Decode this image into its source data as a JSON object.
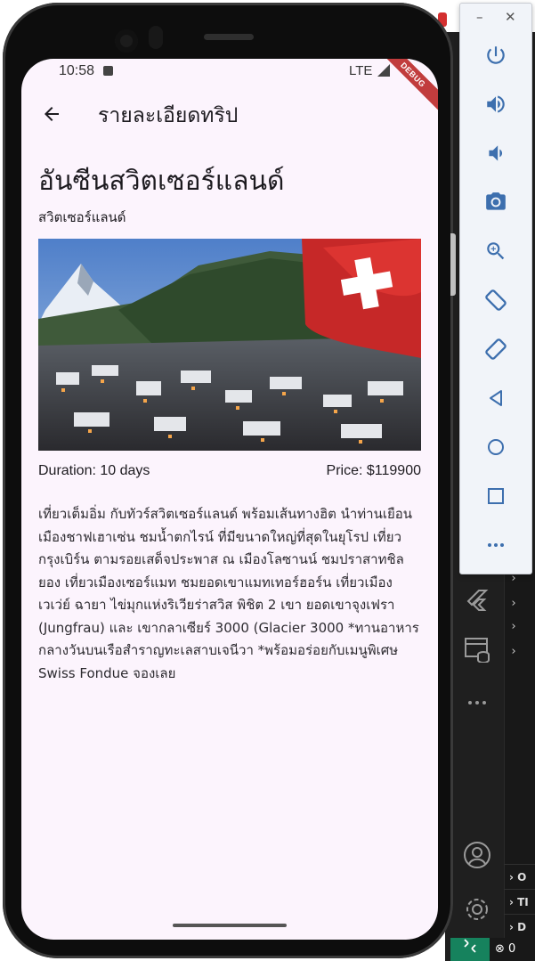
{
  "status_bar": {
    "time": "10:58",
    "network": "LTE"
  },
  "debug_banner": "DEBUG",
  "app_bar": {
    "title": "รายละเอียดทริป"
  },
  "trip": {
    "title": "อันซีนสวิตเซอร์แลนด์",
    "country": "สวิตเซอร์แลนด์",
    "duration": "Duration: 10 days",
    "price": "Price: $119900",
    "description": "เที่ยวเต็มอิ่ม กับทัวร์สวิตเซอร์แลนด์ พร้อมเส้นทางฮิต นำท่านเยือนเมืองชาฟเฮาเซ่น ชมน้ำตกไรน์ ที่มีขนาดใหญ่ที่สุดในยุโรป เที่ยวกรุงเบิร์น ตามรอยเสด็จประพาส ณ เมืองโลซานน์ ชมปราสาทชิลยอง เที่ยวเมืองเซอร์แมท ชมยอดเขาแมทเทอร์ฮอร์น เที่ยวเมืองเวเว่ย์ ฉายา ไข่มุกแห่งริเวียร่าสวิส พิชิต 2 เขา ยอดเขาจุงเฟรา (Jungfrau) และ เขากลาเซียร์ 3000 (Glacier 3000 *ทานอาหารกลางวันบนเรือสำราญทะเลสาบเจนีวา *พร้อมอร่อยกับเมนูพิเศษ Swiss Fondue จองเลย"
  },
  "emulator_toolbar": {
    "minimize": "–",
    "close": "✕",
    "icons": [
      "power-icon",
      "volume-up-icon",
      "volume-down-icon",
      "camera-icon",
      "zoom-icon",
      "rotate-left-icon",
      "rotate-right-icon",
      "back-icon",
      "home-icon",
      "overview-icon",
      "more-icon"
    ]
  },
  "ide": {
    "bottom_rows": [
      "O",
      "TI",
      "D"
    ],
    "status_errors": "0"
  },
  "colors": {
    "screen_bg": "#fcf4fd",
    "text": "#1d1b20",
    "debug_red": "#b71c1c",
    "emulator_icon": "#3d6fae",
    "ide_remote": "#16825d"
  }
}
